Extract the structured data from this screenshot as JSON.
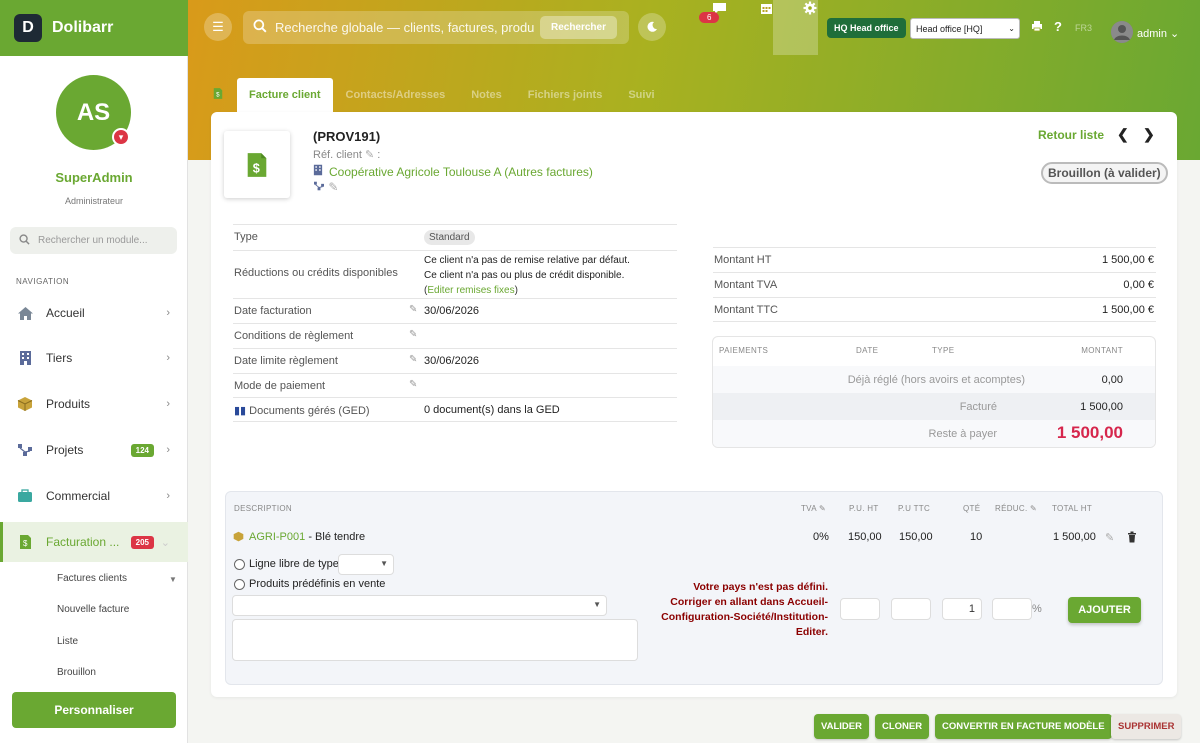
{
  "app": {
    "name": "Dolibarr"
  },
  "user": {
    "initials": "AS",
    "name": "SuperAdmin",
    "role": "Administrateur",
    "menu_label": "admin"
  },
  "sidebar": {
    "search_placeholder": "Rechercher un module...",
    "nav_title": "NAVIGATION",
    "items": [
      {
        "label": "Accueil",
        "icon": "home-icon"
      },
      {
        "label": "Tiers",
        "icon": "building-icon"
      },
      {
        "label": "Produits",
        "icon": "box-icon"
      },
      {
        "label": "Projets",
        "icon": "project-icon",
        "badge": "124"
      },
      {
        "label": "Commercial",
        "icon": "briefcase-icon"
      },
      {
        "label": "Facturation ...",
        "icon": "invoice-icon",
        "badge": "205"
      }
    ],
    "subitems": [
      "Factures clients",
      "Nouvelle facture",
      "Liste",
      "Brouillon"
    ],
    "personalize": "Personnaliser"
  },
  "topbar": {
    "search_placeholder": "Recherche globale — clients, factures, produits...",
    "search_button": "Rechercher",
    "chat_badge": "6",
    "hq_badge": "HQ Head office",
    "entity": "Head office [HQ]",
    "help_text": "FR3"
  },
  "tabs": [
    "Facture client",
    "Contacts/Adresses",
    "Notes",
    "Fichiers joints",
    "Suivi"
  ],
  "invoice": {
    "ref": "(PROV191)",
    "ref_client_label": "Réf. client",
    "ref_client_suffix": ":",
    "customer": "Coopérative Agricole Toulouse A (Autres factures)",
    "back_label": "Retour liste",
    "status": "Brouillon (à valider)"
  },
  "info": [
    {
      "label": "Type",
      "value": "Standard"
    },
    {
      "label": "Réductions ou crédits disponibles",
      "line1": "Ce client n'a pas de remise relative par défaut.",
      "line2": "Ce client n'a pas ou plus de crédit disponible.",
      "link_open": "(",
      "link": "Editer remises fixes",
      "link_close": ")"
    },
    {
      "label": "Date facturation",
      "value": "30/06/2026"
    },
    {
      "label": "Conditions de règlement",
      "value": ""
    },
    {
      "label": "Date limite règlement",
      "value": "30/06/2026"
    },
    {
      "label": "Mode de paiement",
      "value": ""
    },
    {
      "label": "Documents gérés (GED)",
      "value": "0 document(s) dans la GED"
    }
  ],
  "amounts": [
    {
      "label": "Montant HT",
      "value": "1 500,00 €"
    },
    {
      "label": "Montant TVA",
      "value": "0,00 €"
    },
    {
      "label": "Montant TTC",
      "value": "1 500,00 €"
    }
  ],
  "payments": {
    "headers": [
      "PAIEMENTS",
      "DATE",
      "TYPE",
      "MONTANT"
    ],
    "rows": [
      {
        "label": "Déjà réglé (hors avoirs et acomptes)",
        "value": "0,00"
      },
      {
        "label": "Facturé",
        "value": "1 500,00"
      },
      {
        "label": "Reste à payer",
        "value": "1 500,00"
      }
    ]
  },
  "lines": {
    "headers": [
      "DESCRIPTION",
      "TVA",
      "P.U. HT",
      "P.U TTC",
      "QTÉ",
      "RÉDUC.",
      "TOTAL HT"
    ],
    "rows": [
      {
        "ref": "AGRI-P001",
        "desc": "- Blé tendre",
        "tva": "0%",
        "pu_ht": "150,00",
        "pu_ttc": "150,00",
        "qty": "10",
        "total": "1 500,00"
      }
    ],
    "free_line_label": "Ligne libre de type",
    "predefined_label": "Produits prédéfinis en vente",
    "new_qty": "1",
    "percent": "%",
    "warning": [
      "Votre pays n'est pas défini.",
      "Corriger en allant dans Accueil-",
      "Configuration-Société/Institution-",
      "Editer."
    ],
    "add_button": "AJOUTER"
  },
  "actions": [
    "VALIDER",
    "CLONER",
    "CONVERTIR EN FACTURE MODÈLE",
    "SUPPRIMER"
  ],
  "colors": {
    "accent": "#6aa832",
    "danger": "#dc3545"
  }
}
